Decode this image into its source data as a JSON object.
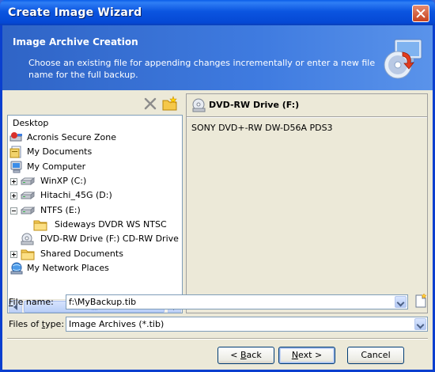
{
  "window": {
    "title": "Create Image Wizard",
    "close_icon": "close-icon"
  },
  "banner": {
    "title": "Image Archive Creation",
    "description": "Choose an existing file for appending changes incrementally or enter a new file name for the full backup.",
    "icon": "disc-backup-icon"
  },
  "tree_toolbar": {
    "delete_icon": "delete-icon",
    "new_folder_icon": "new-folder-icon"
  },
  "tree": {
    "items": [
      {
        "label": "Desktop",
        "icon": "none"
      },
      {
        "label": "Acronis Secure Zone",
        "icon": "secure-zone-icon"
      },
      {
        "label": "My Documents",
        "icon": "documents-icon"
      },
      {
        "label": "My Computer",
        "icon": "computer-icon"
      },
      {
        "label": "WinXP (C:)",
        "icon": "drive-icon",
        "expander": "+"
      },
      {
        "label": "Hitachi_45G (D:)",
        "icon": "drive-icon",
        "expander": "+"
      },
      {
        "label": "NTFS (E:)",
        "icon": "drive-icon",
        "expander": "-"
      },
      {
        "label": "Sideways DVDR WS NTSC",
        "icon": "folder-icon"
      },
      {
        "label": "DVD-RW Drive (F:) CD-RW Drive",
        "icon": "dvd-drive-icon"
      },
      {
        "label": "Shared Documents",
        "icon": "folder-icon",
        "expander": "+"
      },
      {
        "label": "My Network Places",
        "icon": "network-icon"
      }
    ]
  },
  "info_panel": {
    "name": "DVD-RW Drive (F:)",
    "model": "SONY DVD+-RW DW-D56A PDS3",
    "icon": "dvd-drive-icon"
  },
  "form": {
    "file_name_label_prefix": "F",
    "file_name_label_rest": "ile name:",
    "file_name_value": "f:\\MyBackup.tib",
    "file_type_label_prefix": "Files of ",
    "file_type_label_u": "t",
    "file_type_label_rest": "ype:",
    "file_type_value": "Image Archives (*.tib)",
    "new_file_icon": "new-file-icon"
  },
  "buttons": {
    "back_prefix": "< ",
    "back_u": "B",
    "back_rest": "ack",
    "next_u": "N",
    "next_rest": "ext >",
    "cancel": "Cancel"
  },
  "colors": {
    "title_bar": "#0548d4",
    "banner": "#3f7be0",
    "dialog_face": "#ece9d8",
    "close_button": "#c8421e"
  }
}
